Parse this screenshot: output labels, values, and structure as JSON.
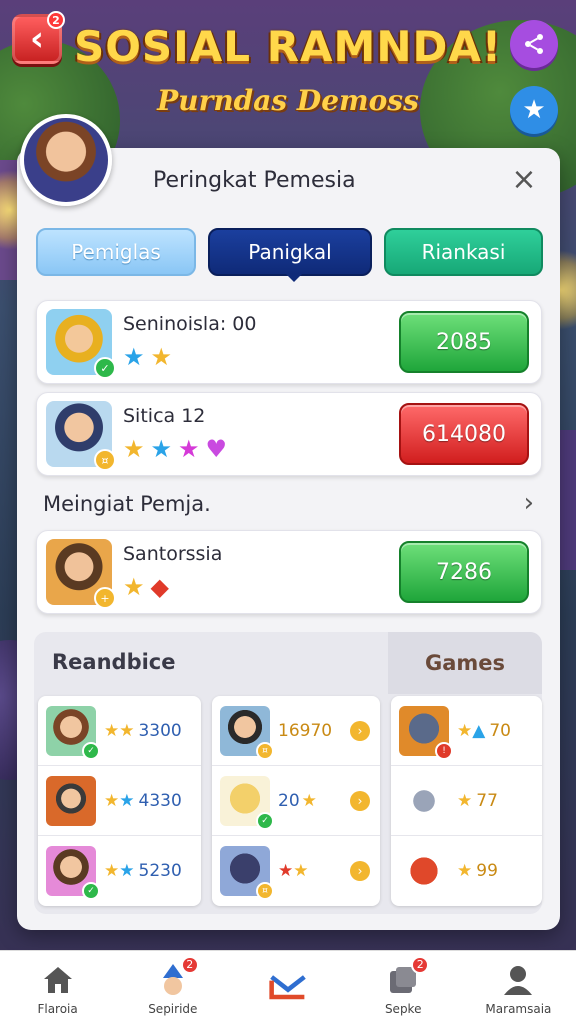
{
  "header": {
    "title": "SOSIAL RAMNDA!",
    "subtitle": "Purndas Demoss",
    "back_badge": "2"
  },
  "panel": {
    "title": "Peringkat Pemesia",
    "close_label": "×"
  },
  "tabs": [
    {
      "label": "Pemiglas",
      "active": false
    },
    {
      "label": "Panigkal",
      "active": true
    },
    {
      "label": "Riankasi",
      "active": false
    }
  ],
  "top_rows": [
    {
      "name": "Seninoisla: 00",
      "score": "2085",
      "score_color": "green",
      "icons": [
        "★",
        "★"
      ]
    },
    {
      "name": "Sitica 12",
      "score": "614080",
      "score_color": "red",
      "icons": [
        "★",
        "★",
        "★",
        "♥"
      ]
    }
  ],
  "section": {
    "label": "Meingiat Pemja."
  },
  "section_rows": [
    {
      "name": "Santorssia",
      "score": "7286",
      "score_color": "green",
      "icons": [
        "★",
        "◆"
      ]
    }
  ],
  "grid": {
    "left_header": "Reandbice",
    "right_header": "Games",
    "col1": [
      {
        "value": "3300"
      },
      {
        "value": "4330"
      },
      {
        "value": "5230"
      }
    ],
    "col2": [
      {
        "value": "16970"
      },
      {
        "value": "20"
      },
      {
        "value": ""
      }
    ],
    "col3": [
      {
        "value": "70"
      },
      {
        "value": "77"
      },
      {
        "value": "99"
      }
    ]
  },
  "bottom_nav": [
    {
      "label": "Flaroia",
      "icon": "home-icon",
      "badge": ""
    },
    {
      "label": "Sepiride",
      "icon": "wizard-icon",
      "badge": "2"
    },
    {
      "label": "",
      "icon": "mail-icon",
      "badge": ""
    },
    {
      "label": "Sepke",
      "icon": "puzzle-icon",
      "badge": "2"
    },
    {
      "label": "Maramsaia",
      "icon": "profile-icon",
      "badge": ""
    }
  ]
}
